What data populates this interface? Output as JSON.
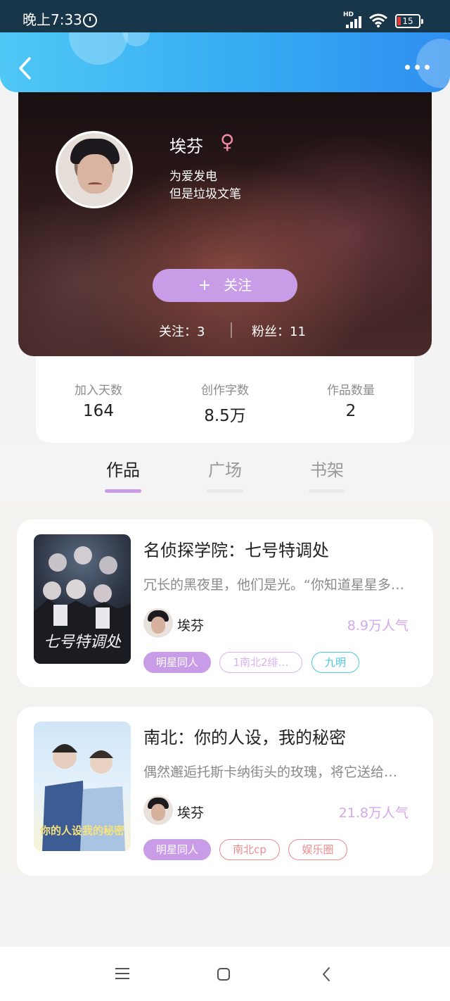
{
  "status_bar": {
    "time": "晚上7:33",
    "network": "HD",
    "battery": "15"
  },
  "header": {
    "back_icon": "chevron-left-icon",
    "more_icon": "more-dots-icon"
  },
  "profile": {
    "name": "埃芬",
    "gender_symbol": "♀",
    "bio_lines": [
      "为爱发电",
      "但是垃圾文笔"
    ],
    "follow_button": {
      "plus": "+",
      "label": "关注"
    },
    "following": "关注：3",
    "fans": "粉丝：11"
  },
  "stats": [
    {
      "label": "加入天数",
      "value": "164"
    },
    {
      "label": "创作字数",
      "value": "8.5万"
    },
    {
      "label": "作品数量",
      "value": "2"
    }
  ],
  "tabs": [
    {
      "label": "作品",
      "active": true
    },
    {
      "label": "广场",
      "active": false
    },
    {
      "label": "书架",
      "active": false
    }
  ],
  "books": [
    {
      "title": "名侦探学院：七号特调处",
      "description": "冗长的黑夜里，他们是光。“你知道星星多…",
      "author": "埃芬",
      "popularity": "8.9万人气",
      "cover_text": "七号特调处",
      "tags": [
        {
          "label": "明星同人",
          "color": "#c89ce6",
          "filled": true
        },
        {
          "label": "1南北2绯…",
          "color": "#d9b2ef",
          "filled": false
        },
        {
          "label": "九明",
          "color": "#49c9dc",
          "filled": false
        }
      ]
    },
    {
      "title": "南北：你的人设，我的秘密",
      "description": "偶然邂逅托斯卡纳街头的玫瑰，将它送给…",
      "author": "埃芬",
      "popularity": "21.8万人气",
      "cover_text": "你的人设我的秘密",
      "tags": [
        {
          "label": "明星同人",
          "color": "#c89ce6",
          "filled": true
        },
        {
          "label": "南北cp",
          "color": "#ea8c8c",
          "filled": false
        },
        {
          "label": "娱乐圈",
          "color": "#ea8c8c",
          "filled": false
        }
      ]
    }
  ],
  "nav": {
    "menu_icon": "menu-icon",
    "home_icon": "home-icon",
    "back_icon": "back-icon"
  }
}
